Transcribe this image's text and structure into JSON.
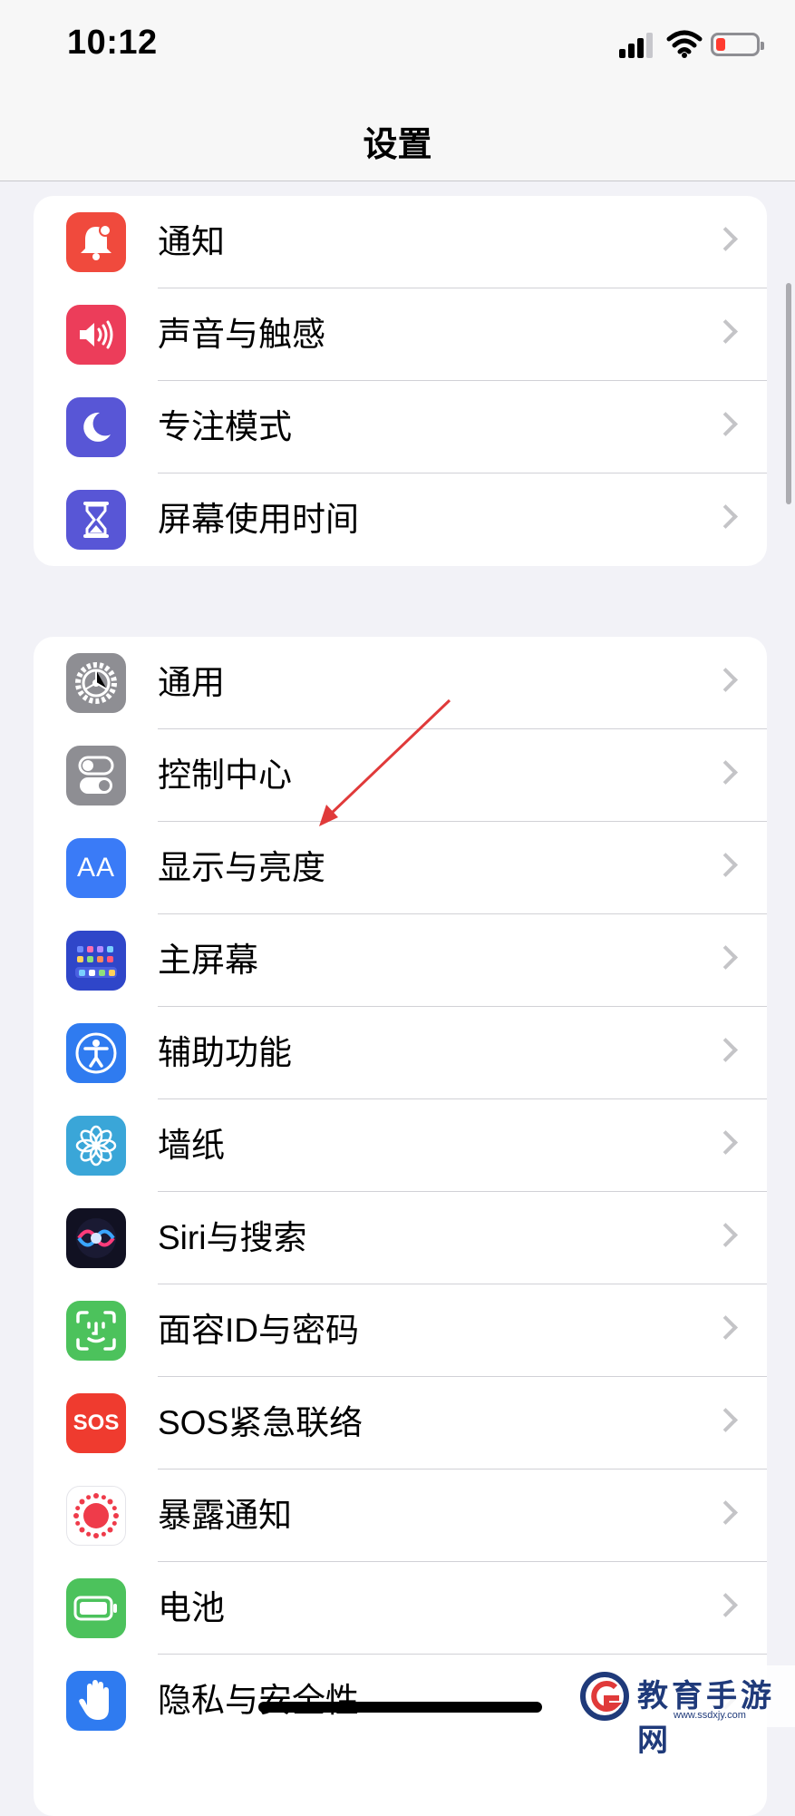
{
  "status_bar": {
    "time": "10:12",
    "battery_level": "low",
    "signal_bars": 3,
    "colors": {
      "battery_low": "#ff3b30"
    }
  },
  "nav": {
    "title": "设置"
  },
  "groups": [
    {
      "items": [
        {
          "label": "通知",
          "icon": "bell-icon",
          "color": "#f04a3d"
        },
        {
          "label": "声音与触感",
          "icon": "speaker-icon",
          "color": "#ec3d5a"
        },
        {
          "label": "专注模式",
          "icon": "moon-icon",
          "color": "#5856d6"
        },
        {
          "label": "屏幕使用时间",
          "icon": "hourglass-icon",
          "color": "#5856d6"
        }
      ]
    },
    {
      "items": [
        {
          "label": "通用",
          "icon": "gear-icon",
          "color": "#8e8e93"
        },
        {
          "label": "控制中心",
          "icon": "toggles-icon",
          "color": "#8e8e93"
        },
        {
          "label": "显示与亮度",
          "icon": "display-aa-icon",
          "color": "#3a7bf7",
          "glyph": "AA"
        },
        {
          "label": "主屏幕",
          "icon": "home-screen-icon",
          "color": "#2f46c9"
        },
        {
          "label": "辅助功能",
          "icon": "accessibility-icon",
          "color": "#2f7bf0"
        },
        {
          "label": "墙纸",
          "icon": "wallpaper-flower-icon",
          "color": "#3aa6d8"
        },
        {
          "label": "Siri与搜索",
          "icon": "siri-icon",
          "color": "#222233"
        },
        {
          "label": "面容ID与密码",
          "icon": "face-id-icon",
          "color": "#4cc25c"
        },
        {
          "label": "SOS紧急联络",
          "icon": "sos-icon",
          "color": "#ef3b2f",
          "glyph": "SOS"
        },
        {
          "label": "暴露通知",
          "icon": "exposure-icon",
          "color": "#ffffff"
        },
        {
          "label": "电池",
          "icon": "battery-icon",
          "color": "#4cc25c"
        },
        {
          "label": "隐私与安全性",
          "icon": "hand-icon",
          "color": "#2f7bf0"
        }
      ]
    }
  ],
  "watermark": {
    "text": "教育手游网",
    "url": "www.ssdxjy.com"
  },
  "annotation": {
    "type": "arrow",
    "color": "#e03a3a"
  }
}
